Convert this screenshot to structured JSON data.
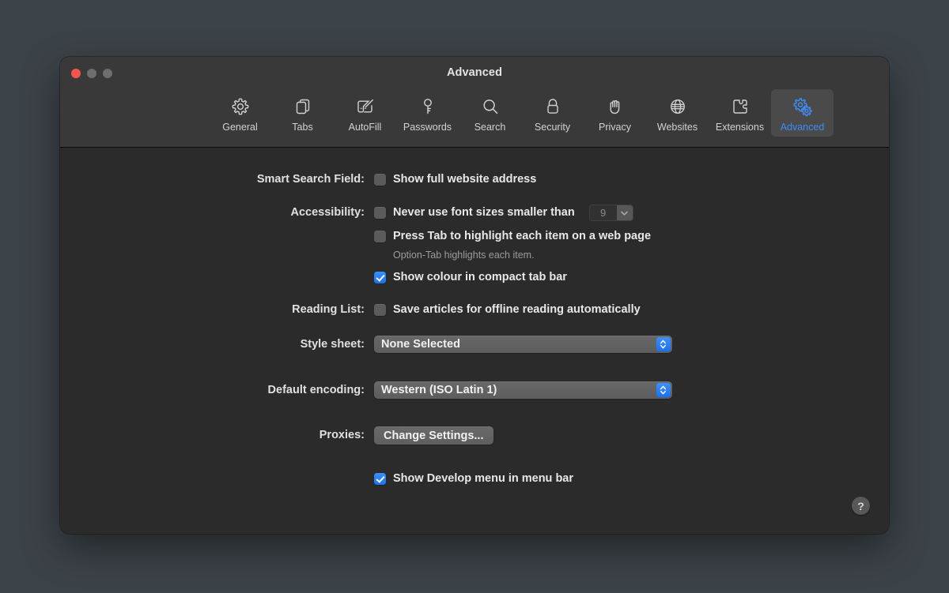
{
  "window": {
    "title": "Advanced",
    "traffic_lights": [
      {
        "name": "close",
        "color": "#f2564c"
      },
      {
        "name": "minimize",
        "color": "#6e6e6e"
      },
      {
        "name": "zoom",
        "color": "#6e6e6e"
      }
    ]
  },
  "toolbar": {
    "selected": "Advanced",
    "accent_color": "#3f8cf5",
    "items": [
      {
        "label": "General",
        "icon": "gear-icon"
      },
      {
        "label": "Tabs",
        "icon": "tabs-icon"
      },
      {
        "label": "AutoFill",
        "icon": "autofill-pencil-icon"
      },
      {
        "label": "Passwords",
        "icon": "key-icon"
      },
      {
        "label": "Search",
        "icon": "magnifier-icon"
      },
      {
        "label": "Security",
        "icon": "lock-icon"
      },
      {
        "label": "Privacy",
        "icon": "hand-icon"
      },
      {
        "label": "Websites",
        "icon": "globe-icon"
      },
      {
        "label": "Extensions",
        "icon": "puzzle-piece-icon"
      },
      {
        "label": "Advanced",
        "icon": "double-gear-icon"
      }
    ]
  },
  "settings": {
    "smart_search_field": {
      "label": "Smart Search Field:",
      "show_full_address": {
        "label": "Show full website address",
        "checked": false
      }
    },
    "accessibility": {
      "label": "Accessibility:",
      "min_font_size": {
        "label": "Never use font sizes smaller than",
        "checked": false,
        "value": "9",
        "enabled": false
      },
      "press_tab": {
        "label": "Press Tab to highlight each item on a web page",
        "checked": false,
        "hint": "Option-Tab highlights each item."
      },
      "show_colour_tab_bar": {
        "label": "Show colour in compact tab bar",
        "checked": true
      }
    },
    "reading_list": {
      "label": "Reading List:",
      "save_offline": {
        "label": "Save articles for offline reading automatically",
        "checked": false
      }
    },
    "style_sheet": {
      "label": "Style sheet:",
      "value": "None Selected"
    },
    "default_encoding": {
      "label": "Default encoding:",
      "value": "Western (ISO Latin 1)"
    },
    "proxies": {
      "label": "Proxies:",
      "button_label": "Change Settings..."
    },
    "show_develop_menu": {
      "label": "Show Develop menu in menu bar",
      "checked": true
    },
    "help": {
      "glyph": "?"
    }
  }
}
